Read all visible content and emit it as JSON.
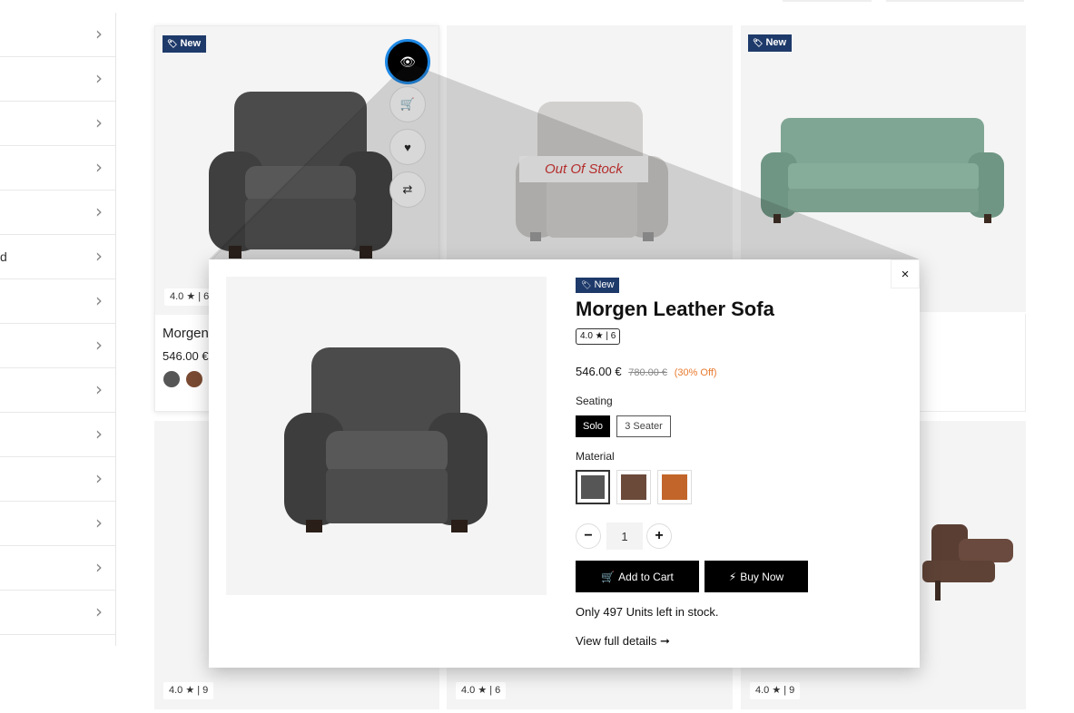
{
  "sidebar": {
    "items": [
      {
        "label": ""
      },
      {
        "label": ""
      },
      {
        "label": ""
      },
      {
        "label": ""
      },
      {
        "label": ""
      },
      {
        "label": "d"
      },
      {
        "label": ""
      },
      {
        "label": ""
      },
      {
        "label": ""
      },
      {
        "label": ""
      },
      {
        "label": ""
      },
      {
        "label": ""
      },
      {
        "label": ""
      },
      {
        "label": ""
      }
    ],
    "chevron": "›"
  },
  "badge_new": "New",
  "cards": {
    "main": {
      "rating": "4.0 ★ | 6",
      "name": "Morgen",
      "price": "546.00 €"
    },
    "middle": {
      "stock_label": "Out Of Stock"
    },
    "bottom_left": {
      "rating": "4.0 ★ | 9"
    },
    "bottom_mid": {
      "rating": "4.0 ★ | 6"
    },
    "bottom_right": {
      "rating": "4.0 ★ | 9"
    }
  },
  "modal": {
    "close": "×",
    "badge": "New",
    "title": "Morgen Leather Sofa",
    "rating": "4.0 ★ | 6",
    "price": "546.00 €",
    "old_price": "780.00 €",
    "discount": "(30% Off)",
    "seating_label": "Seating",
    "seating_options": [
      "Solo",
      "3 Seater"
    ],
    "material_label": "Material",
    "materials": [
      "#555655",
      "#6b4a3a",
      "#c2652a"
    ],
    "qty_minus": "−",
    "qty_plus": "+",
    "quantity": "1",
    "add_to_cart": "Add to Cart",
    "buy_now": "Buy Now",
    "stock_text": "Only 497 Units left in stock.",
    "view_details": "View full details ➞"
  },
  "colors": {
    "badge_bg": "#1e3a6a",
    "accent_ring": "#1e88e5",
    "discount": "#e97a2f",
    "out_of_stock": "#d32f2f"
  },
  "icons": [
    "eye-icon",
    "cart-icon",
    "heart-icon",
    "compare-icon",
    "tag-icon",
    "close-icon",
    "bolt-icon",
    "arrow-right-icon"
  ]
}
